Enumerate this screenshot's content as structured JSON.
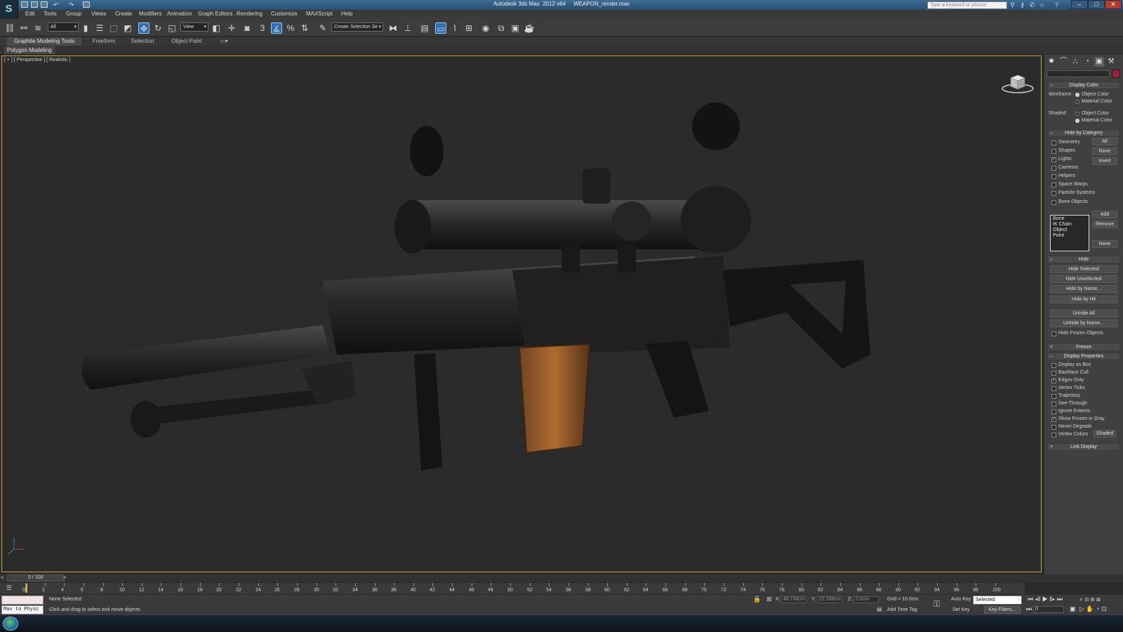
{
  "app": {
    "title": "Autodesk 3ds Max  2012 x64     WEAPON_render.max",
    "logo": "3ds-max-logo",
    "search_placeholder": "Type a keyword or phrase"
  },
  "menu": [
    "Edit",
    "Tools",
    "Group",
    "Views",
    "Create",
    "Modifiers",
    "Animation",
    "Graph Editors",
    "Rendering",
    "Customize",
    "MAXScript",
    "Help"
  ],
  "toolbar": {
    "selection_filter": "All",
    "ref_coord": "View",
    "named_selection": "Create Selection Se",
    "snap_label": "3"
  },
  "ribbon": {
    "tabs": [
      "Graphite Modeling Tools",
      "Freeform",
      "Selection",
      "Object Paint"
    ],
    "sub_label": "Polygon Modeling"
  },
  "viewport": {
    "label": "[ + ] [ Perspective ] [ Realistic ]"
  },
  "command_panel": {
    "display_color": {
      "title": "Display Color",
      "wireframe_label": "Wireframe:",
      "shaded_label": "Shaded:",
      "object_color": "Object Color",
      "material_color": "Material Color"
    },
    "hide_by_category": {
      "title": "Hide by Category",
      "items": [
        {
          "label": "Geometry",
          "checked": false
        },
        {
          "label": "Shapes",
          "checked": false
        },
        {
          "label": "Lights",
          "checked": true
        },
        {
          "label": "Cameras",
          "checked": false
        },
        {
          "label": "Helpers",
          "checked": false
        },
        {
          "label": "Space Warps",
          "checked": false
        },
        {
          "label": "Particle Systems",
          "checked": false
        },
        {
          "label": "Bone Objects",
          "checked": false
        }
      ],
      "all_btn": "All",
      "none_btn": "None",
      "invert_btn": "Invert",
      "list_items": [
        "Bone",
        "IK Chain Object",
        "Point"
      ],
      "add_btn": "Add",
      "remove_btn": "Remove",
      "none2_btn": "None"
    },
    "hide": {
      "title": "Hide",
      "buttons": [
        "Hide Selected",
        "Hide Unselected",
        "Hide by Name...",
        "Hide by Hit",
        "Unhide All",
        "Unhide by Name..."
      ],
      "hide_frozen": "Hide Frozen Objects"
    },
    "freeze_title": "Freeze",
    "display_properties": {
      "title": "Display Properties",
      "items": [
        {
          "label": "Display as Box",
          "checked": false
        },
        {
          "label": "Backface Cull",
          "checked": false
        },
        {
          "label": "Edges Only",
          "checked": true
        },
        {
          "label": "Vertex Ticks",
          "checked": false
        },
        {
          "label": "Trajectory",
          "checked": false
        },
        {
          "label": "See-Through",
          "checked": false
        },
        {
          "label": "Ignore Extents",
          "checked": false
        },
        {
          "label": "Show Frozen in Gray",
          "checked": true
        },
        {
          "label": "Never Degrade",
          "checked": false
        },
        {
          "label": "Vertex Colors",
          "checked": false
        }
      ],
      "shaded_btn": "Shaded"
    },
    "link_display_title": "Link Display"
  },
  "timeline": {
    "frame_readout": "0 / 100",
    "ticks": [
      "0",
      "2",
      "4",
      "6",
      "8",
      "10",
      "12",
      "14",
      "16",
      "18",
      "20",
      "22",
      "24",
      "26",
      "28",
      "30",
      "32",
      "34",
      "36",
      "38",
      "40",
      "42",
      "44",
      "46",
      "48",
      "50",
      "52",
      "54",
      "56",
      "58",
      "60",
      "62",
      "64",
      "66",
      "68",
      "70",
      "72",
      "74",
      "76",
      "78",
      "80",
      "82",
      "84",
      "86",
      "88",
      "90",
      "92",
      "94",
      "96",
      "98",
      "100"
    ]
  },
  "status": {
    "maxscript_text": "Max to Physc",
    "selection_status": "None Selected",
    "prompt": "Click and drag to select and move objects",
    "x_label": "X:",
    "x_value": "48.748cm",
    "y_label": "Y:",
    "y_value": "22.338cm",
    "z_label": "Z:",
    "z_value": "0.0cm",
    "grid": "Grid = 10.0cm",
    "add_time_tag": "Add Time Tag",
    "auto_key": "Auto Key",
    "key_mode": "Selected",
    "set_key": "Set Key",
    "key_filters": "Key Filters...",
    "frame_field": "0"
  },
  "colors": {
    "viewport_bg": "#2b2b2b",
    "viewport_border": "#c7a748",
    "accent_blue": "#2f6fb5",
    "object_color_swatch": "#9b1f3b"
  }
}
